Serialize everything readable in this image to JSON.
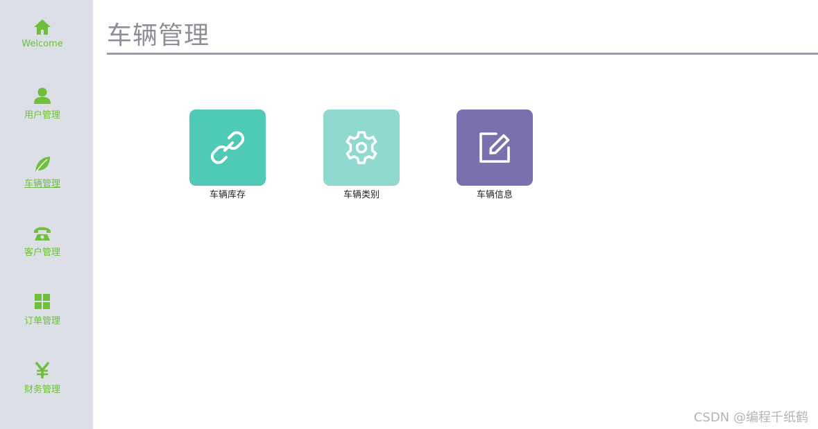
{
  "sidebar": {
    "items": [
      {
        "label": "Welcome",
        "icon": "home-icon"
      },
      {
        "label": "用户管理",
        "icon": "user-icon"
      },
      {
        "label": "车辆管理",
        "icon": "leaf-icon",
        "active": true
      },
      {
        "label": "客户管理",
        "icon": "phone-icon"
      },
      {
        "label": "订单管理",
        "icon": "grid-icon"
      },
      {
        "label": "财务管理",
        "icon": "yen-icon"
      }
    ]
  },
  "main": {
    "title": "车辆管理",
    "tiles": [
      {
        "label": "车辆库存",
        "icon": "link-icon",
        "color": "#4ecab7"
      },
      {
        "label": "车辆类别",
        "icon": "gear-icon",
        "color": "#90d9cf"
      },
      {
        "label": "车辆信息",
        "icon": "edit-icon",
        "color": "#7a70ad"
      }
    ]
  },
  "watermark": "CSDN @编程千纸鹤",
  "colors": {
    "sidebar_bg": "#dcdfe6",
    "nav_green": "#6fbe3c",
    "title_gray": "#8e8e94"
  }
}
